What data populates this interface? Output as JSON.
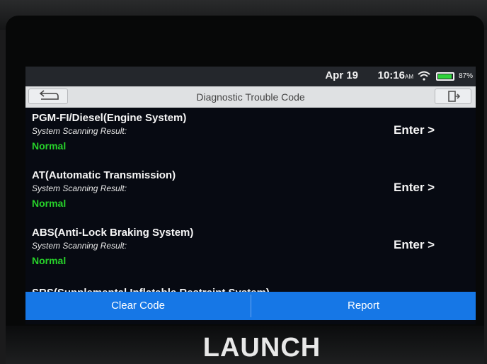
{
  "status_bar": {
    "date": "Apr 19",
    "time": "10:16",
    "ampm": "AM",
    "battery": "87%",
    "battery_level": 0.87
  },
  "header": {
    "title": "Diagnostic Trouble Code",
    "back_icon": "back-arrow-icon",
    "exit_icon": "exit-icon"
  },
  "systems": [
    {
      "name": "PGM-FI/Diesel(Engine System)",
      "subtitle": "System Scanning Result:",
      "status": "Normal",
      "action": "Enter >"
    },
    {
      "name": "AT(Automatic Transmission)",
      "subtitle": "System Scanning Result:",
      "status": "Normal",
      "action": "Enter >"
    },
    {
      "name": "ABS(Anti-Lock Braking System)",
      "subtitle": "System Scanning Result:",
      "status": "Normal",
      "action": "Enter >"
    }
  ],
  "partial_item": "SRS(Supplemental Inflatable Restraint System)",
  "footer": {
    "clear_label": "Clear Code",
    "report_label": "Report"
  },
  "brand": "LAUNCH",
  "colors": {
    "accent": "#1677e6",
    "status_ok": "#27d22a",
    "background": "#070a12"
  }
}
